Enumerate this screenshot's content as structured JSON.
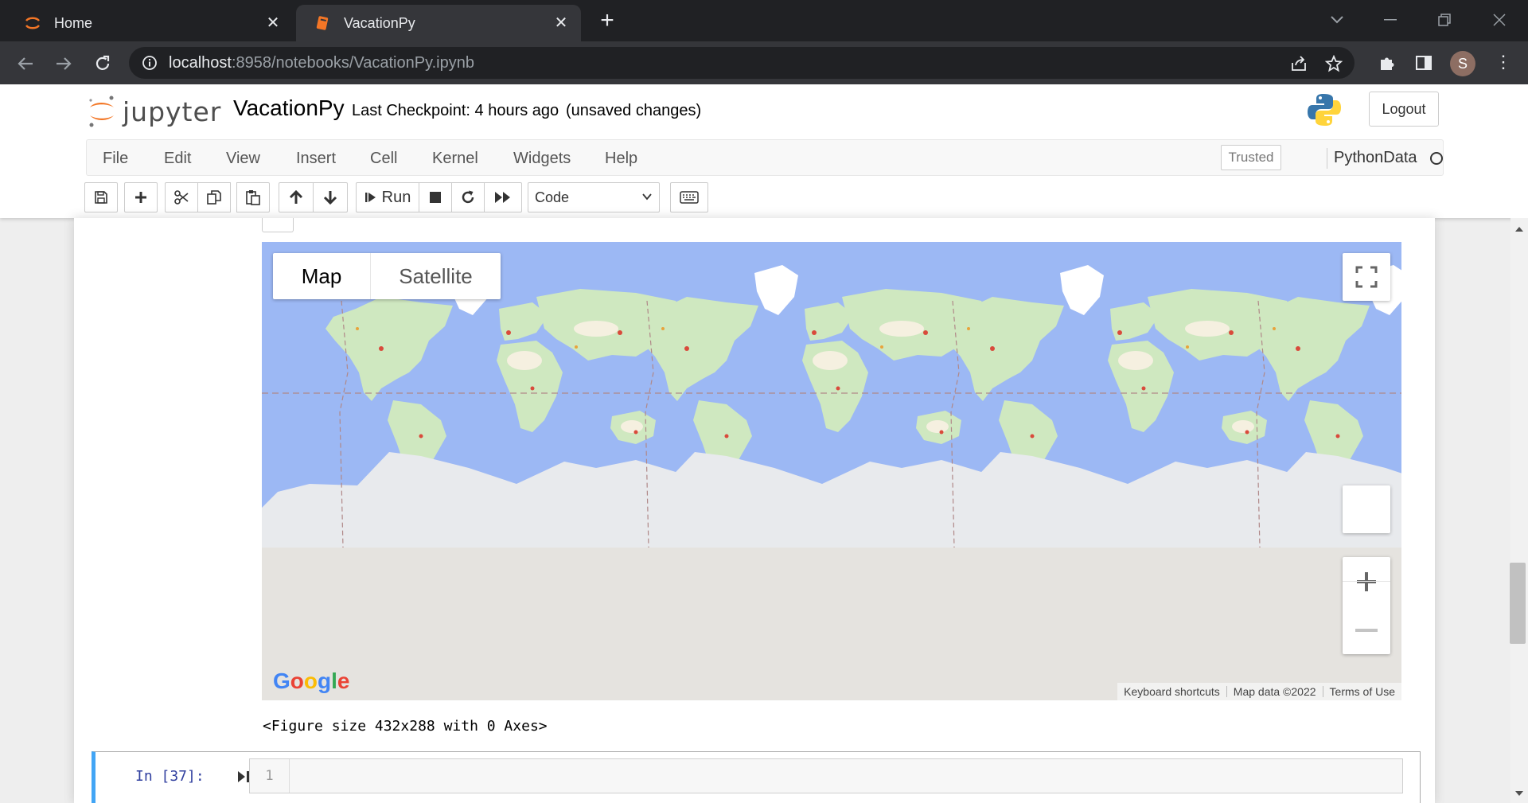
{
  "browser": {
    "tabs": [
      {
        "title": "Home",
        "icon": "jupyter-favicon"
      },
      {
        "title": "VacationPy",
        "icon": "notebook-favicon"
      }
    ],
    "url_host": "localhost",
    "url_rest": ":8958/notebooks/VacationPy.ipynb",
    "profile_initial": "S"
  },
  "jupyter": {
    "logo_text": "jupyter",
    "notebook_name": "VacationPy",
    "checkpoint": "Last Checkpoint: 4 hours ago",
    "unsaved": "(unsaved changes)",
    "logout": "Logout",
    "menu": [
      "File",
      "Edit",
      "View",
      "Insert",
      "Cell",
      "Kernel",
      "Widgets",
      "Help"
    ],
    "trusted": "Trusted",
    "kernel": "PythonData",
    "toolbar": {
      "run_label": "Run",
      "cell_type": "Code"
    }
  },
  "map": {
    "type_buttons": [
      "Map",
      "Satellite"
    ],
    "selected_type": "Map",
    "google": "Google",
    "attribution": [
      "Keyboard shortcuts",
      "Map data ©2022",
      "Terms of Use"
    ],
    "colors": {
      "ocean": "#9cb8f4",
      "land": "#cfe8c0",
      "ice": "#e8eaed",
      "grey": "#e5e3df"
    }
  },
  "output": {
    "figure_text": "<Figure size 432x288 with 0 Axes>"
  },
  "next_cell": {
    "prompt": "In [37]:",
    "line_number": "1"
  }
}
